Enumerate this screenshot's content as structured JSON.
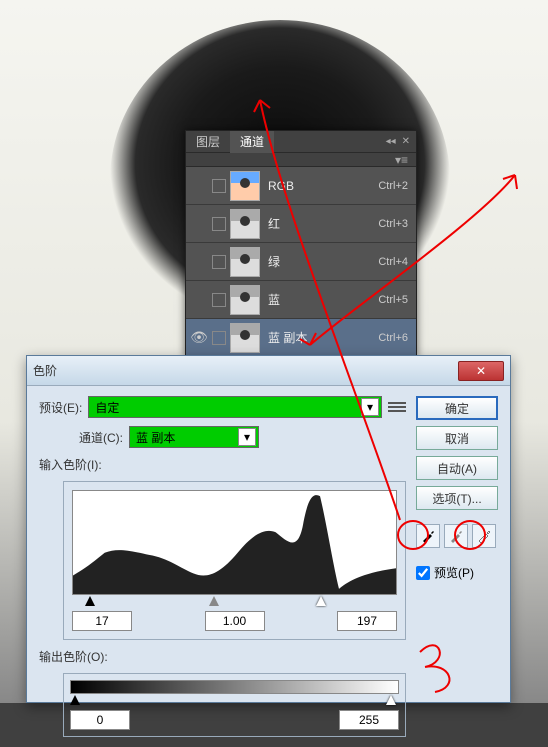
{
  "channels_panel": {
    "tabs": [
      {
        "label": "图层",
        "active": false
      },
      {
        "label": "通道",
        "active": true
      }
    ],
    "rows": [
      {
        "name": "RGB",
        "shortcut": "Ctrl+2",
        "thumb": "rgb",
        "visible": false,
        "selected": false
      },
      {
        "name": "红",
        "shortcut": "Ctrl+3",
        "thumb": "bw",
        "visible": false,
        "selected": false
      },
      {
        "name": "绿",
        "shortcut": "Ctrl+4",
        "thumb": "bw",
        "visible": false,
        "selected": false
      },
      {
        "name": "蓝",
        "shortcut": "Ctrl+5",
        "thumb": "bw",
        "visible": false,
        "selected": false
      },
      {
        "name": "蓝 副本",
        "shortcut": "Ctrl+6",
        "thumb": "bw",
        "visible": true,
        "selected": true
      }
    ]
  },
  "levels_dialog": {
    "title": "色阶",
    "preset_label": "预设(E):",
    "preset_value": "自定",
    "channel_label": "通道(C):",
    "channel_value": "蓝 副本",
    "input_label": "输入色阶(I):",
    "output_label": "输出色阶(O):",
    "input_values": {
      "shadow": "17",
      "mid": "1.00",
      "highlight": "197"
    },
    "output_values": {
      "black": "0",
      "white": "255"
    },
    "buttons": {
      "ok": "确定",
      "cancel": "取消",
      "auto": "自动(A)",
      "options": "选项(T)..."
    },
    "preview_label": "预览(P)",
    "preview_checked": true
  }
}
